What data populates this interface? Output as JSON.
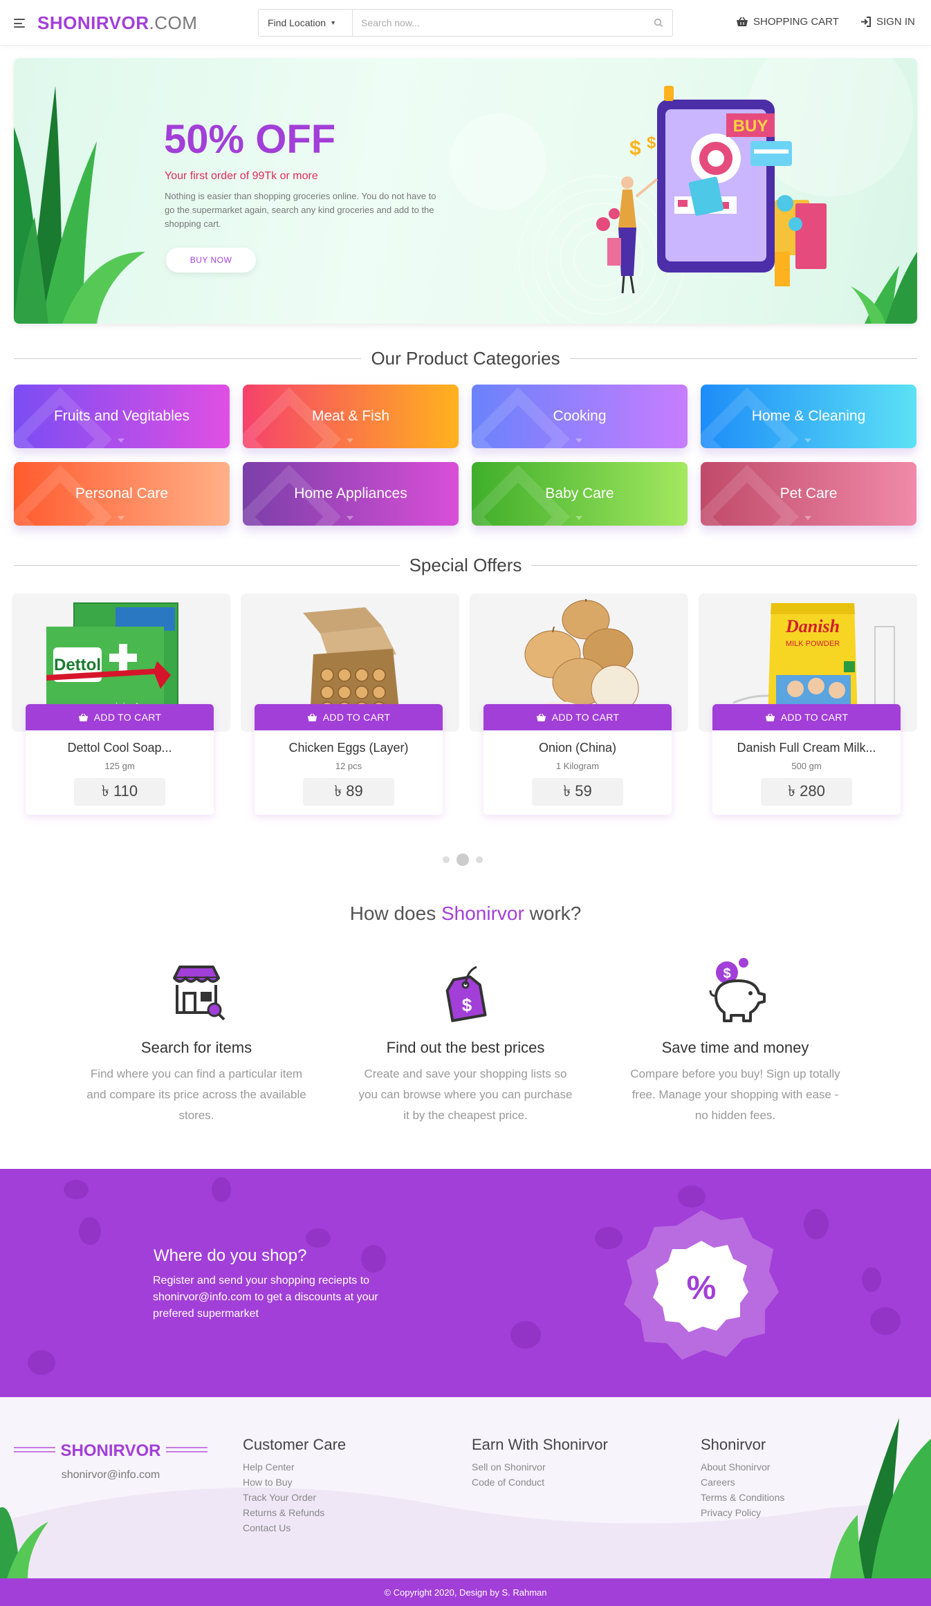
{
  "header": {
    "brand_bold": "SHONIRVOR",
    "brand_suffix": ".COM",
    "location_label": "Find Location",
    "search_placeholder": "Search now...",
    "cart_label": "SHOPPING CART",
    "signin_label": "SIGN IN"
  },
  "hero": {
    "title": "50% OFF",
    "subtitle": "Your first order of 99Tk or more",
    "text": "Nothing is easier than shopping groceries online. You do not have to go the supermarket again, search any kind groceries and add to the shopping cart.",
    "button": "BUY NOW",
    "illustration_label": "BUY"
  },
  "categories": {
    "title": "Our Product Categories",
    "items": [
      {
        "label": "Fruits and Vegitables",
        "colors": [
          "#7b4df3",
          "#e04fe3"
        ]
      },
      {
        "label": "Meat & Fish",
        "colors": [
          "#f6416c",
          "#ffb21e"
        ]
      },
      {
        "label": "Cooking",
        "colors": [
          "#6a82fb",
          "#c77dff"
        ]
      },
      {
        "label": "Home & Cleaning",
        "colors": [
          "#1d8cf8",
          "#5ce1f5"
        ]
      },
      {
        "label": "Personal Care",
        "colors": [
          "#ff5b2e",
          "#ffb088"
        ]
      },
      {
        "label": "Home Appliances",
        "colors": [
          "#7b3fa8",
          "#d94fd8"
        ]
      },
      {
        "label": "Baby Care",
        "colors": [
          "#3fae2a",
          "#a3e860"
        ]
      },
      {
        "label": "Pet Care",
        "colors": [
          "#c04a6a",
          "#f08aa8"
        ]
      }
    ]
  },
  "offers": {
    "title": "Special Offers",
    "add_to_cart": "ADD TO CART",
    "products": [
      {
        "name": "Dettol Cool Soap...",
        "unit": "125 gm",
        "price": "৳ 110",
        "image": "dettol-soap-pack",
        "brand": "Dettol"
      },
      {
        "name": "Chicken Eggs (Layer)",
        "unit": "12 pcs",
        "price": "৳ 89",
        "image": "egg-carton"
      },
      {
        "name": "Onion (China)",
        "unit": "1 Kilogram",
        "price": "৳ 59",
        "image": "onions"
      },
      {
        "name": "Danish Full Cream Milk...",
        "unit": "500 gm",
        "price": "৳ 280",
        "image": "milk-powder-pack",
        "brand": "Danish"
      }
    ],
    "carousel_active_page": 2,
    "carousel_pages": 3
  },
  "how": {
    "title_start": "How does ",
    "title_brand": "Shonirvor",
    "title_end": " work?",
    "steps": [
      {
        "title": "Search for items",
        "text": "Find where you can find a particular item and compare its price across the available stores.",
        "icon": "store-search-icon"
      },
      {
        "title": "Find out the best prices",
        "text": "Create and save your shopping lists so you can browse where you can purchase it by the cheapest price.",
        "icon": "price-tag-icon"
      },
      {
        "title": "Save time and money",
        "text": "Compare before you buy! Sign up totally free. Manage your shopping with ease - no hidden fees.",
        "icon": "piggy-bank-icon"
      }
    ]
  },
  "band": {
    "title": "Where do you shop?",
    "text": "Register and send your shopping reciepts to shonirvor@info.com to get a discounts at your prefered supermarket",
    "badge": "%"
  },
  "footer": {
    "brand": "SHONIRVOR",
    "email": "shonirvor@info.com",
    "columns": [
      {
        "title": "Customer Care",
        "links": [
          "Help Center",
          "How to Buy",
          "Track Your Order",
          "Returns & Refunds",
          "Contact Us"
        ]
      },
      {
        "title": "Earn With Shonirvor",
        "links": [
          "Sell on Shonirvor",
          "Code of Conduct"
        ]
      },
      {
        "title": "Shonirvor",
        "links": [
          "About Shonirvor",
          "Careers",
          "Terms & Conditions",
          "Privacy Policy"
        ]
      }
    ],
    "copyright": "© Copyright 2020, Design by S. Rahman"
  },
  "colors": {
    "brand": "#a23fd8",
    "accent_red": "#e02a5a"
  }
}
